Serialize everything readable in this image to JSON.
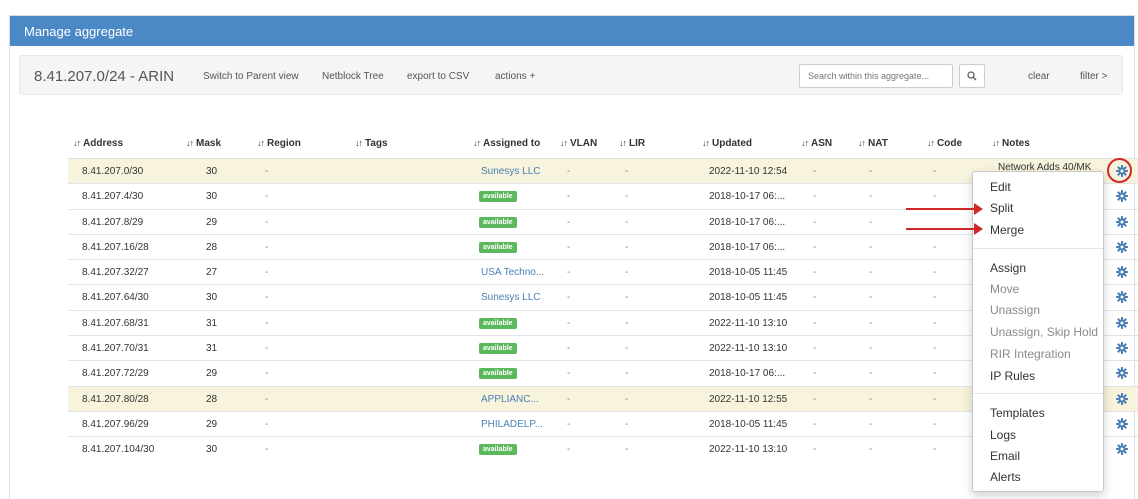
{
  "panel": {
    "title": "Manage aggregate"
  },
  "toolbar": {
    "aggregate": "8.41.207.0/24 - ARIN",
    "switch_parent": "Switch to Parent view",
    "netblock_tree": "Netblock Tree",
    "export_csv": "export to CSV",
    "actions": "actions +",
    "search_placeholder": "Search within this aggregate...",
    "clear": "clear",
    "filter": "filter >"
  },
  "columns": [
    "Address",
    "Mask",
    "Region",
    "Tags",
    "Assigned to",
    "VLAN",
    "LIR",
    "Updated",
    "ASN",
    "NAT",
    "Code",
    "Notes"
  ],
  "rows": [
    {
      "address": "8.41.207.0/30",
      "mask": "30",
      "region": "-",
      "assigned": "Sunesys LLC",
      "assigned_type": "link",
      "vlan": "-",
      "lir": "-",
      "updated": "2022-11-10 12:54",
      "asn": "-",
      "nat": "-",
      "code": "-",
      "highlight": true
    },
    {
      "address": "8.41.207.4/30",
      "mask": "30",
      "region": "-",
      "assigned": "available",
      "assigned_type": "badge",
      "vlan": "-",
      "lir": "-",
      "updated": "2018-10-17 06:...",
      "asn": "-",
      "nat": "-",
      "code": "-",
      "highlight": false
    },
    {
      "address": "8.41.207.8/29",
      "mask": "29",
      "region": "-",
      "assigned": "available",
      "assigned_type": "badge",
      "vlan": "-",
      "lir": "-",
      "updated": "2018-10-17 06:...",
      "asn": "-",
      "nat": "-",
      "code": "",
      "highlight": false
    },
    {
      "address": "8.41.207.16/28",
      "mask": "28",
      "region": "-",
      "assigned": "available",
      "assigned_type": "badge",
      "vlan": "-",
      "lir": "-",
      "updated": "2018-10-17 06:...",
      "asn": "-",
      "nat": "-",
      "code": "-",
      "highlight": false
    },
    {
      "address": "8.41.207.32/27",
      "mask": "27",
      "region": "-",
      "assigned": "USA Techno...",
      "assigned_type": "link",
      "vlan": "-",
      "lir": "-",
      "updated": "2018-10-05 11:45",
      "asn": "-",
      "nat": "-",
      "code": "-",
      "highlight": false
    },
    {
      "address": "8.41.207.64/30",
      "mask": "30",
      "region": "-",
      "assigned": "Sunesys LLC",
      "assigned_type": "link",
      "vlan": "-",
      "lir": "-",
      "updated": "2018-10-05 11:45",
      "asn": "-",
      "nat": "-",
      "code": "-",
      "highlight": false
    },
    {
      "address": "8.41.207.68/31",
      "mask": "31",
      "region": "-",
      "assigned": "available",
      "assigned_type": "badge",
      "vlan": "-",
      "lir": "-",
      "updated": "2022-11-10 13:10",
      "asn": "-",
      "nat": "-",
      "code": "-",
      "highlight": false
    },
    {
      "address": "8.41.207.70/31",
      "mask": "31",
      "region": "-",
      "assigned": "available",
      "assigned_type": "badge",
      "vlan": "-",
      "lir": "-",
      "updated": "2022-11-10 13:10",
      "asn": "-",
      "nat": "-",
      "code": "-",
      "highlight": false
    },
    {
      "address": "8.41.207.72/29",
      "mask": "29",
      "region": "-",
      "assigned": "available",
      "assigned_type": "badge",
      "vlan": "-",
      "lir": "-",
      "updated": "2018-10-17 06:...",
      "asn": "-",
      "nat": "-",
      "code": "-",
      "highlight": false
    },
    {
      "address": "8.41.207.80/28",
      "mask": "28",
      "region": "-",
      "assigned": "APPLIANC...",
      "assigned_type": "link",
      "vlan": "-",
      "lir": "-",
      "updated": "2022-11-10 12:55",
      "asn": "-",
      "nat": "-",
      "code": "-",
      "highlight": true
    },
    {
      "address": "8.41.207.96/29",
      "mask": "29",
      "region": "-",
      "assigned": "PHILADELP...",
      "assigned_type": "link",
      "vlan": "-",
      "lir": "-",
      "updated": "2018-10-05 11:45",
      "asn": "-",
      "nat": "-",
      "code": "-",
      "highlight": false
    },
    {
      "address": "8.41.207.104/30",
      "mask": "30",
      "region": "-",
      "assigned": "available",
      "assigned_type": "badge",
      "vlan": "-",
      "lir": "-",
      "updated": "2022-11-10 13:10",
      "asn": "-",
      "nat": "-",
      "code": "-",
      "highlight": false
    }
  ],
  "first_row_notes": "Network Adds 40/MK",
  "menu": {
    "edit": "Edit",
    "split": "Split",
    "merge": "Merge",
    "assign": "Assign",
    "move": "Move",
    "unassign": "Unassign",
    "unassign_skip": "Unassign, Skip Hold",
    "rir": "RIR Integration",
    "ip_rules": "IP Rules",
    "templates": "Templates",
    "logs": "Logs",
    "email": "Email",
    "alerts": "Alerts"
  },
  "colors": {
    "header": "#4a88c6",
    "highlight": "#f7f3dc",
    "badge": "#5cb85c",
    "link": "#4a7fb5",
    "annotation": "#d02828"
  }
}
